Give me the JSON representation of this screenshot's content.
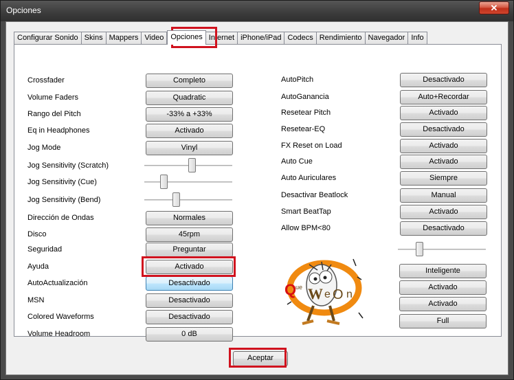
{
  "window": {
    "title": "Opciones",
    "close_glyph": "✕"
  },
  "tabs": [
    {
      "label": "Configurar Sonido"
    },
    {
      "label": "Skins"
    },
    {
      "label": "Mappers"
    },
    {
      "label": "Video"
    },
    {
      "label": "Opciones",
      "active": true
    },
    {
      "label": "Internet"
    },
    {
      "label": "iPhone/iPad"
    },
    {
      "label": "Codecs"
    },
    {
      "label": "Rendimiento"
    },
    {
      "label": "Navegador"
    },
    {
      "label": "Info"
    }
  ],
  "left": [
    {
      "label": "Crossfader",
      "value": "Completo"
    },
    {
      "label": "Volume Faders",
      "value": "Quadratic"
    },
    {
      "label": "Rango del Pitch",
      "value": "-33% a +33%"
    },
    {
      "label": "Eq in Headphones",
      "value": "Activado"
    },
    {
      "label": "Jog Mode",
      "value": "Vinyl"
    },
    {
      "label": "Jog Sensitivity (Scratch)",
      "slider": 0.55
    },
    {
      "label": "Jog Sensitivity (Cue)",
      "slider": 0.2
    },
    {
      "label": "Jog Sensitivity (Bend)",
      "slider": 0.35
    },
    {
      "label": "Dirección de Ondas",
      "value": "Normales"
    },
    {
      "label": "Disco",
      "value": "45rpm"
    },
    {
      "label": "Seguridad",
      "value": "Preguntar"
    },
    {
      "label": "Ayuda",
      "value": "Activado"
    },
    {
      "label": "AutoActualización",
      "value": "Desactivado",
      "focused": true
    },
    {
      "label": "MSN",
      "value": "Desactivado"
    },
    {
      "label": "Colored Waveforms",
      "value": "Desactivado"
    },
    {
      "label": "Volume Headroom",
      "value": "0 dB"
    }
  ],
  "right": [
    {
      "label": "AutoPitch",
      "value": "Desactivado"
    },
    {
      "label": "AutoGanancia",
      "value": "Auto+Recordar"
    },
    {
      "label": "Resetear Pitch",
      "value": "Activado"
    },
    {
      "label": "Resetear-EQ",
      "value": "Desactivado"
    },
    {
      "label": "FX Reset on Load",
      "value": "Activado"
    },
    {
      "label": "Auto Cue",
      "value": "Activado"
    },
    {
      "label": "Auto Auriculares",
      "value": "Siempre"
    },
    {
      "label": "Desactivar Beatlock",
      "value": "Manual"
    },
    {
      "label": "Smart BeatTap",
      "value": "Activado"
    },
    {
      "label": "Allow BPM<80",
      "value": "Desactivado"
    }
  ],
  "right_slider": 0.22,
  "right_extra_buttons": [
    "Inteligente",
    "Activado",
    "Activado",
    "Full"
  ],
  "logo": {
    "text": "QueWeOn",
    "colors": {
      "orange": "#f08a10",
      "red": "#d81010",
      "brown": "#6b4a1a"
    }
  },
  "ok_button": "Aceptar",
  "highlight_color": "#d0121e"
}
